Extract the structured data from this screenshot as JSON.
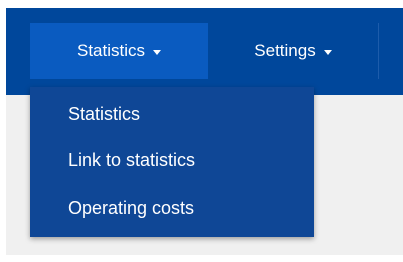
{
  "nav": {
    "items": [
      {
        "label": "Statistics",
        "has_dropdown": true,
        "active": true
      },
      {
        "label": "Settings",
        "has_dropdown": true,
        "active": false
      }
    ]
  },
  "dropdown": {
    "items": [
      {
        "label": "Statistics"
      },
      {
        "label": "Link to statistics"
      },
      {
        "label": "Operating costs"
      }
    ]
  },
  "colors": {
    "navbar": "#00479b",
    "active_nav_item": "#0a5bc0",
    "dropdown_bg": "#0f4796",
    "text": "#ffffff",
    "content_bg": "#f0f0f0"
  }
}
